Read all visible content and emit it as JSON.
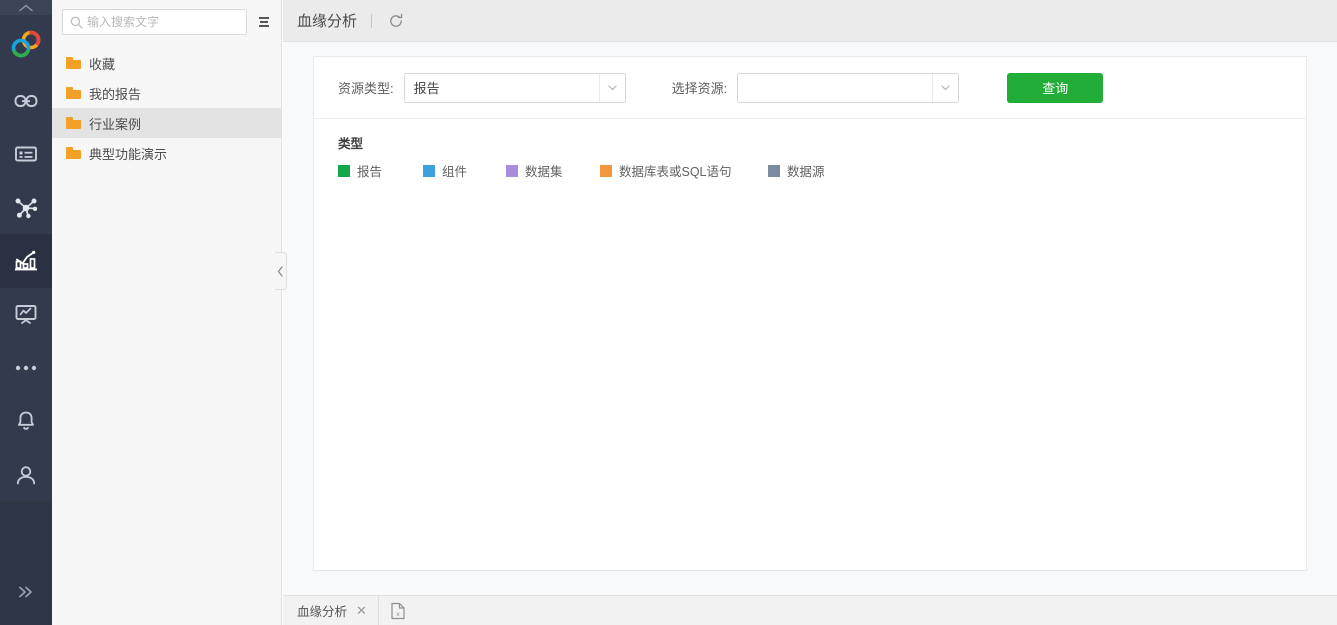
{
  "rail": {
    "top_collapse_icon": "chevron-up-icon",
    "logo_icon": "rings-logo-icon",
    "items": [
      {
        "key": "link",
        "icon": "link-icon",
        "active": false
      },
      {
        "key": "catalog",
        "icon": "list-card-icon",
        "active": false
      },
      {
        "key": "network",
        "icon": "network-nodes-icon",
        "active": false
      },
      {
        "key": "analysis",
        "icon": "bar-chart-icon",
        "active": true
      },
      {
        "key": "dashboard",
        "icon": "presentation-icon",
        "active": false
      },
      {
        "key": "more",
        "icon": "ellipsis-icon",
        "active": false
      },
      {
        "key": "notification",
        "icon": "bell-icon",
        "active": false
      },
      {
        "key": "user",
        "icon": "user-icon",
        "active": false
      }
    ],
    "bottom_expand_icon": "double-chevron-right-icon"
  },
  "tree": {
    "search": {
      "placeholder": "输入搜索文字",
      "value": "",
      "icon": "search-icon"
    },
    "menu_icon": "list-menu-icon",
    "items": [
      {
        "label": "收藏",
        "selected": false
      },
      {
        "label": "我的报告",
        "selected": false
      },
      {
        "label": "行业案例",
        "selected": true
      },
      {
        "label": "典型功能演示",
        "selected": false
      }
    ],
    "collapse_icon": "chevron-left-icon"
  },
  "header": {
    "title": "血缘分析",
    "refresh_icon": "refresh-icon"
  },
  "filters": {
    "resource_type_label": "资源类型:",
    "resource_type_value": "报告",
    "resource_type_placeholder": "",
    "select_resource_label": "选择资源:",
    "select_resource_value": "",
    "select_resource_placeholder": "",
    "query_button": "查询",
    "query_button_color": "#22ac38",
    "dropdown_icon": "chevron-down-icon"
  },
  "legend": {
    "title": "类型",
    "items": [
      {
        "label": "报告",
        "color": "#13a74b"
      },
      {
        "label": "组件",
        "color": "#3ba2dd"
      },
      {
        "label": "数据集",
        "color": "#a88ce0"
      },
      {
        "label": "数据库表或SQL语句",
        "color": "#f2973e"
      },
      {
        "label": "数据源",
        "color": "#7b8ca0"
      }
    ]
  },
  "tabbar": {
    "tabs": [
      {
        "label": "血缘分析",
        "close_icon": "close-icon"
      }
    ],
    "doc_icon": "document-excel-icon"
  }
}
